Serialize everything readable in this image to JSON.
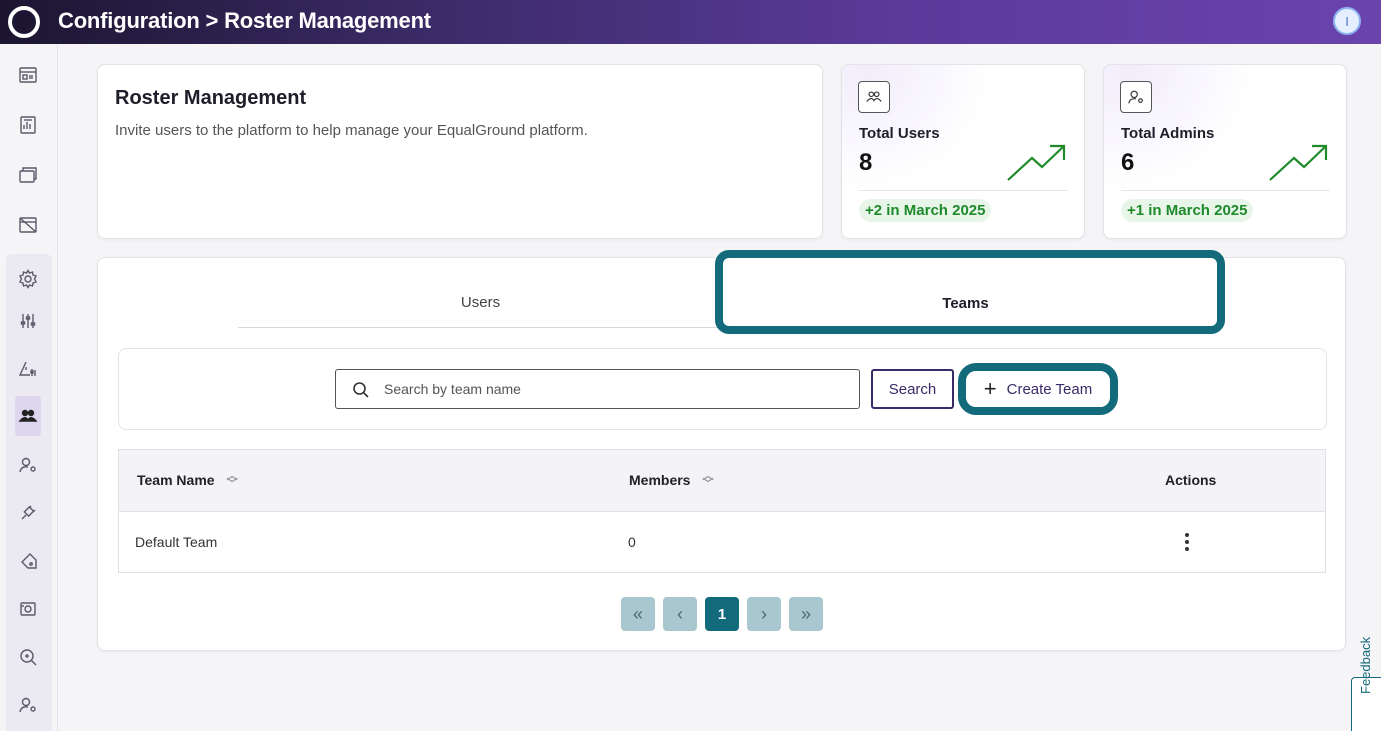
{
  "header": {
    "title": "Configuration > Roster Management",
    "avatar_initial": "I"
  },
  "sidebar": {
    "items": [
      {
        "icon": "dashboard-icon"
      },
      {
        "icon": "report-icon"
      },
      {
        "icon": "windows-icon"
      },
      {
        "icon": "calendar-off-icon"
      },
      {
        "icon": "gear-icon"
      },
      {
        "icon": "sliders-icon"
      },
      {
        "icon": "alert-settings-icon"
      },
      {
        "icon": "users-icon"
      },
      {
        "icon": "user-settings-icon"
      },
      {
        "icon": "plug-icon"
      },
      {
        "icon": "tag-icon"
      },
      {
        "icon": "camera-icon"
      },
      {
        "icon": "search-zoom-icon"
      },
      {
        "icon": "user-settings-icon"
      }
    ],
    "active": "users-icon"
  },
  "intro": {
    "title": "Roster Management",
    "description": "Invite users to the platform to help manage your EqualGround platform."
  },
  "stats": [
    {
      "label": "Total Users",
      "value": "8",
      "change": "+2 in March 2025",
      "icon": "users-icon"
    },
    {
      "label": "Total Admins",
      "value": "6",
      "change": "+1 in March 2025",
      "icon": "admin-icon"
    }
  ],
  "tabs": [
    {
      "label": "Users",
      "active": false
    },
    {
      "label": "Teams",
      "active": true
    }
  ],
  "toolbar": {
    "search_placeholder": "Search by team name",
    "search_value": "",
    "search_label": "Search",
    "create_label": "Create Team"
  },
  "table": {
    "headers": [
      "Team Name",
      "Members",
      "Actions"
    ],
    "rows": [
      {
        "name": "Default Team",
        "members": "0"
      }
    ]
  },
  "pagination": {
    "current": "1",
    "first": "«",
    "prev": "‹",
    "next": "›",
    "last": "»"
  },
  "feedback_label": "Feedback",
  "colors": {
    "accent": "#136a7a",
    "brand": "#3a2a66",
    "success": "#1e8a2a"
  }
}
